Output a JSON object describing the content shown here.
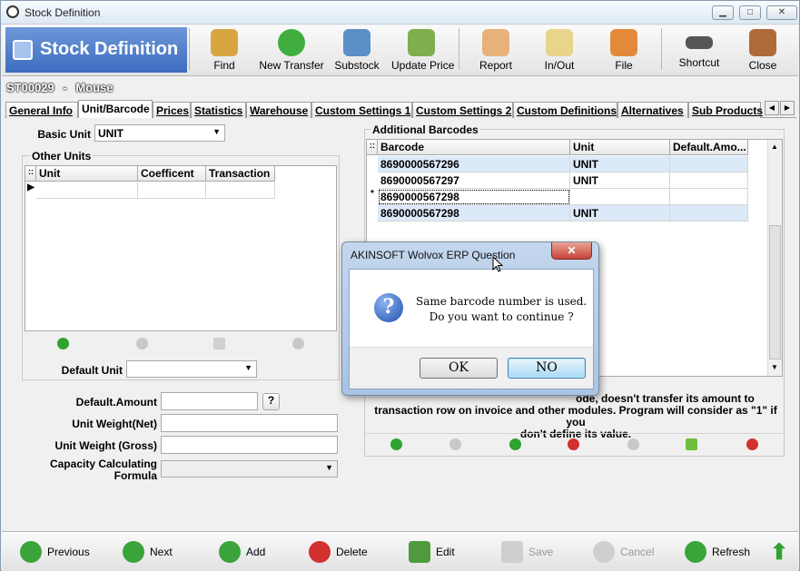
{
  "window": {
    "title": "Stock Definition",
    "controls": {
      "minimize": "▁",
      "maximize": "□",
      "close": "✕"
    }
  },
  "brand": {
    "title": "Stock Definition"
  },
  "toolbar": {
    "find": "Find",
    "new_transfer": "New Transfer",
    "substock": "Substock",
    "update_price": "Update Price",
    "report": "Report",
    "in_out": "In/Out",
    "file": "File",
    "shortcut": "Shortcut",
    "close": "Close"
  },
  "record": {
    "code": "ST00029",
    "separator": "-",
    "name": "Mouse"
  },
  "tabs": [
    {
      "label": "General Info"
    },
    {
      "label": "Unit/Barcode"
    },
    {
      "label": "Prices"
    },
    {
      "label": "Statistics"
    },
    {
      "label": "Warehouse"
    },
    {
      "label": "Custom Settings 1"
    },
    {
      "label": "Custom Settings 2"
    },
    {
      "label": "Custom Definitions"
    },
    {
      "label": "Alternatives"
    },
    {
      "label": "Sub Products"
    }
  ],
  "unit_section": {
    "basic_unit_label": "Basic Unit",
    "basic_unit_value": "UNIT",
    "other_units_title": "Other Units",
    "columns": [
      "Unit",
      "Coefficent",
      "Transaction"
    ],
    "default_unit_label": "Default Unit",
    "default_unit_value": ""
  },
  "form": {
    "default_amount_label": "Default.Amount",
    "help_label": "?",
    "unit_weight_net_label": "Unit Weight(Net)",
    "unit_weight_gross_label": "Unit Weight (Gross)",
    "capacity_formula_label_1": "Capacity Calculating",
    "capacity_formula_label_2": "Formula"
  },
  "barcodes": {
    "title": "Additional Barcodes",
    "columns": [
      "Barcode",
      "Unit",
      "Default.Amo..."
    ],
    "rows": [
      {
        "barcode": "8690000567296",
        "unit": "UNIT",
        "default_amount": "",
        "marker": ""
      },
      {
        "barcode": "8690000567297",
        "unit": "UNIT",
        "default_amount": "",
        "marker": ""
      },
      {
        "barcode": "8690000567298",
        "unit": "",
        "default_amount": "",
        "marker": "*"
      },
      {
        "barcode": "8690000567298",
        "unit": "UNIT",
        "default_amount": "",
        "marker": ""
      }
    ],
    "note_line1": "ode, doesn't transfer its amount to",
    "note_line2": "transaction row on invoice and other modules. Program will consider as \"1\" if you",
    "note_line3": "don't define its value."
  },
  "bottom": {
    "previous": "Previous",
    "next": "Next",
    "add": "Add",
    "delete": "Delete",
    "edit": "Edit",
    "save": "Save",
    "cancel": "Cancel",
    "refresh": "Refresh"
  },
  "dialog": {
    "title": "AKINSOFT Wolvox ERP Question",
    "close": "✕",
    "line1": "Same barcode number is used.",
    "line2": "Do you want to continue ?",
    "ok": "OK",
    "no": "NO"
  },
  "colors": {
    "brand_bg": "#4a78c8",
    "selected_row": "#dce9f8",
    "add_green": "#2fa32f",
    "delete_red": "#d33030"
  }
}
